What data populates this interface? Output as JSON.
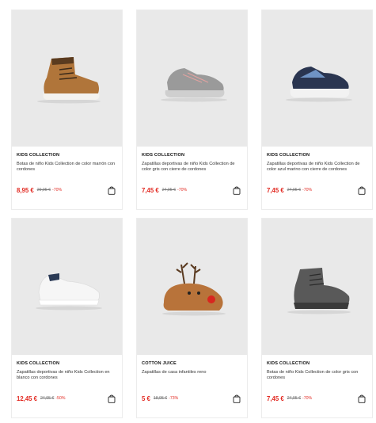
{
  "products": [
    {
      "brand": "KIDS COLLECTION",
      "title": "Botas de niño Kids Collection de color marrón con cordones",
      "price": "8,95 €",
      "old_price": "29,95 €",
      "discount": "-70%",
      "image_icon": "brown-boot-image"
    },
    {
      "brand": "KIDS COLLECTION",
      "title": "Zapatillas deportivas de niño Kids Collection de color gris con cierre de cordones",
      "price": "7,45 €",
      "old_price": "24,95 €",
      "discount": "-70%",
      "image_icon": "grey-sneaker-image"
    },
    {
      "brand": "KIDS COLLECTION",
      "title": "Zapatillas deportivas de niño Kids Collection de color azul marino con cierre de cordones",
      "price": "7,45 €",
      "old_price": "24,95 €",
      "discount": "-70%",
      "image_icon": "navy-sneaker-image"
    },
    {
      "brand": "KIDS COLLECTION",
      "title": "Zapatillas deportivas de niño Kids Collection en blanco con cordones",
      "price": "12,45 €",
      "old_price": "24,95 €",
      "discount": "-50%",
      "image_icon": "white-sneaker-image"
    },
    {
      "brand": "COTTON JUICE",
      "title": "Zapatillas de casa infantiles reno",
      "price": "5 €",
      "old_price": "18,95 €",
      "discount": "-73%",
      "image_icon": "reindeer-slipper-image"
    },
    {
      "brand": "KIDS COLLECTION",
      "title": "Botas de niño Kids Collection de color gris con cordones",
      "price": "7,45 €",
      "old_price": "24,95 €",
      "discount": "-70%",
      "image_icon": "grey-high-top-image"
    }
  ],
  "colors": {
    "price": "#e22a22",
    "image_bg": "#e9e9e9",
    "text": "#333333"
  },
  "icons": {
    "add_to_bag": "shopping-bag-icon"
  }
}
